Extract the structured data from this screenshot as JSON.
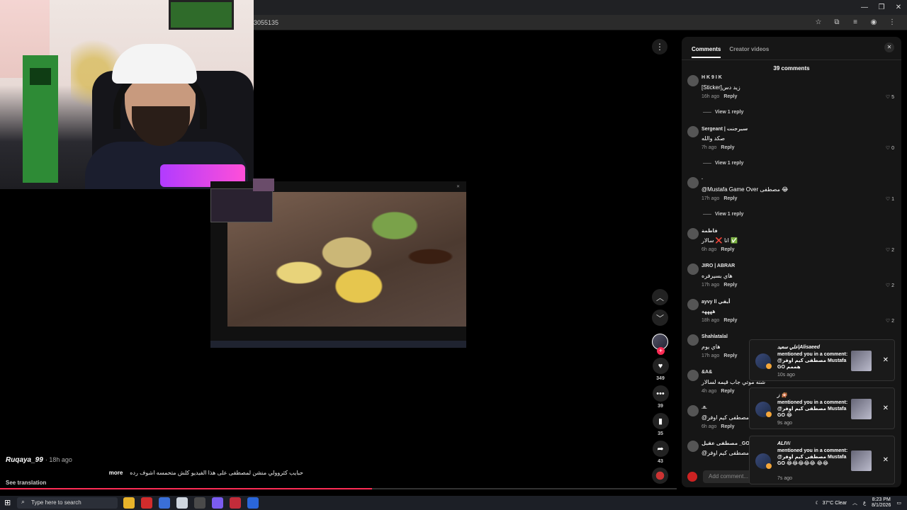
{
  "browser": {
    "url_fragment": "3055135",
    "window_controls": [
      "—",
      "❐",
      "✕"
    ],
    "toolbar_icons": [
      "star-icon",
      "extensions-icon",
      "media-icon",
      "profile-icon",
      "menu-icon"
    ]
  },
  "video": {
    "creator_handle": "Ruqaya_99",
    "posted": "· 18h ago",
    "caption": "حبايب كثروولي منشن لمصطفى على هذا الفيديو كلش متحمسه اشوف رده",
    "more_label": "more",
    "translate_label": "See translation",
    "progress_fraction": 0.55
  },
  "actions": {
    "likes": "349",
    "comments": "39",
    "saves": "35",
    "shares": "43"
  },
  "comments_panel": {
    "tabs": [
      "Comments",
      "Creator videos"
    ],
    "count_label": "39 comments",
    "add_placeholder": "Add comment...",
    "reply_label": "Reply",
    "items": [
      {
        "name": "H K 9 I K",
        "text": "[Sticker]زيد دس",
        "time": "16h ago",
        "likes": "5",
        "replies": "View 1 reply"
      },
      {
        "name": "Sergeant | سيرجنت",
        "text": "صكد والله",
        "time": "7h ago",
        "likes": "0",
        "replies": "View 1 reply"
      },
      {
        "name": "·",
        "text": "@Mustafa Game Over مصطفى 😂",
        "time": "17h ago",
        "likes": "1",
        "replies": "View 1 reply"
      },
      {
        "name": "فاطمة",
        "text": "انا ❌ سالار ✅",
        "time": "6h ago",
        "likes": "2",
        "replies": ""
      },
      {
        "name": "JIRO | ABRAR",
        "text": "هاي بسيرفره",
        "time": "17h ago",
        "likes": "2",
        "replies": ""
      },
      {
        "name": "ayvy ll أيفي",
        "text": "ههههه",
        "time": "18h ago",
        "likes": "2",
        "replies": ""
      },
      {
        "name": "Shahlatalal",
        "text": "هاي يوم",
        "time": "17h ago",
        "likes": "",
        "replies": ""
      },
      {
        "name": "&A&",
        "text": "شنه موتي جاب قيمه لسالار",
        "time": "4h ago",
        "likes": "",
        "replies": ""
      },
      {
        "name": ".a.",
        "text": "@مصطفى كيم اوفر l",
        "time": "6h ago",
        "likes": "",
        "replies": ""
      },
      {
        "name": "مصطفى عقيل _GO",
        "text": "@مصطفى كيم اوفر l",
        "time": "",
        "likes": "",
        "replies": ""
      }
    ]
  },
  "notifications": [
    {
      "title": "علي سعيد|Alisaeed",
      "body": "mentioned you in a comment: @مصطفى كيم اوفر Mustafa GO هممم",
      "time": "10s ago"
    },
    {
      "title": "ز 🎇",
      "body": "mentioned you in a comment: @مصطفى كيم اوفر Mustafa GO 😂",
      "time": "9s ago"
    },
    {
      "title": "ALI𝕎",
      "body": "mentioned you in a comment: @مصطفى كيم اوفر Mustafa GO 😂😂😂😂😂 😂😂",
      "time": "7s ago"
    }
  ],
  "taskbar": {
    "search_placeholder": "Type here to search",
    "weather": "37°C  Clear",
    "time": "8:23 PM",
    "date": "8/1/2026",
    "lang": "ع"
  },
  "colors": {
    "accent": "#fe2c55",
    "panel_bg": "#161616"
  }
}
